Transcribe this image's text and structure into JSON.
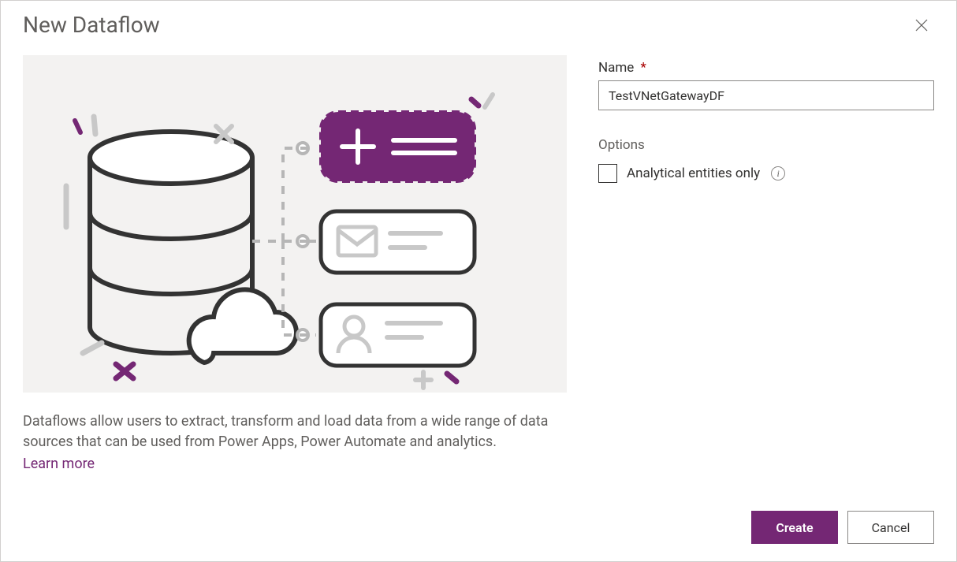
{
  "dialog": {
    "title": "New Dataflow",
    "description": "Dataflows allow users to extract, transform and load data from a wide range of data sources that can be used from Power Apps, Power Automate and analytics.",
    "learn_more": "Learn more"
  },
  "form": {
    "name_label": "Name",
    "required_mark": "*",
    "name_value": "TestVNetGatewayDF",
    "options_header": "Options",
    "analytical_label": "Analytical entities only",
    "analytical_checked": false,
    "info_glyph": "i"
  },
  "footer": {
    "create_label": "Create",
    "cancel_label": "Cancel"
  },
  "colors": {
    "accent": "#742774",
    "background_panel": "#f3f2f1",
    "text_secondary": "#605e5c"
  }
}
